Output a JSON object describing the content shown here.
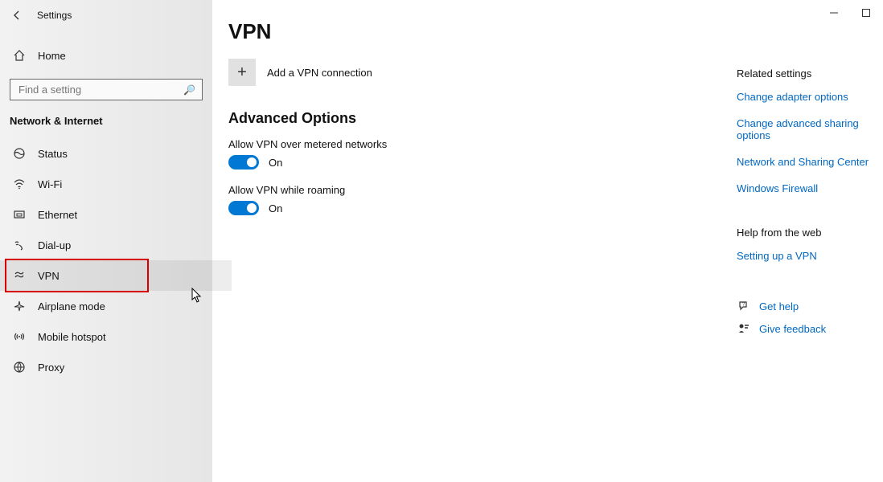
{
  "window": {
    "title": "Settings"
  },
  "sidebar": {
    "home_label": "Home",
    "search_placeholder": "Find a setting",
    "section_header": "Network & Internet",
    "items": [
      {
        "icon": "status-icon",
        "label": "Status"
      },
      {
        "icon": "wifi-icon",
        "label": "Wi-Fi"
      },
      {
        "icon": "ethernet-icon",
        "label": "Ethernet"
      },
      {
        "icon": "dialup-icon",
        "label": "Dial-up"
      },
      {
        "icon": "vpn-icon",
        "label": "VPN"
      },
      {
        "icon": "airplane-icon",
        "label": "Airplane mode"
      },
      {
        "icon": "hotspot-icon",
        "label": "Mobile hotspot"
      },
      {
        "icon": "proxy-icon",
        "label": "Proxy"
      }
    ]
  },
  "main": {
    "title": "VPN",
    "add_label": "Add a VPN connection",
    "advanced_header": "Advanced Options",
    "opt1": {
      "label": "Allow VPN over metered networks",
      "state": "On"
    },
    "opt2": {
      "label": "Allow VPN while roaming",
      "state": "On"
    }
  },
  "right": {
    "related_header": "Related settings",
    "links": [
      "Change adapter options",
      "Change advanced sharing options",
      "Network and Sharing Center",
      "Windows Firewall"
    ],
    "help_header": "Help from the web",
    "help_links": [
      "Setting up a VPN"
    ],
    "get_help_label": "Get help",
    "feedback_label": "Give feedback"
  }
}
